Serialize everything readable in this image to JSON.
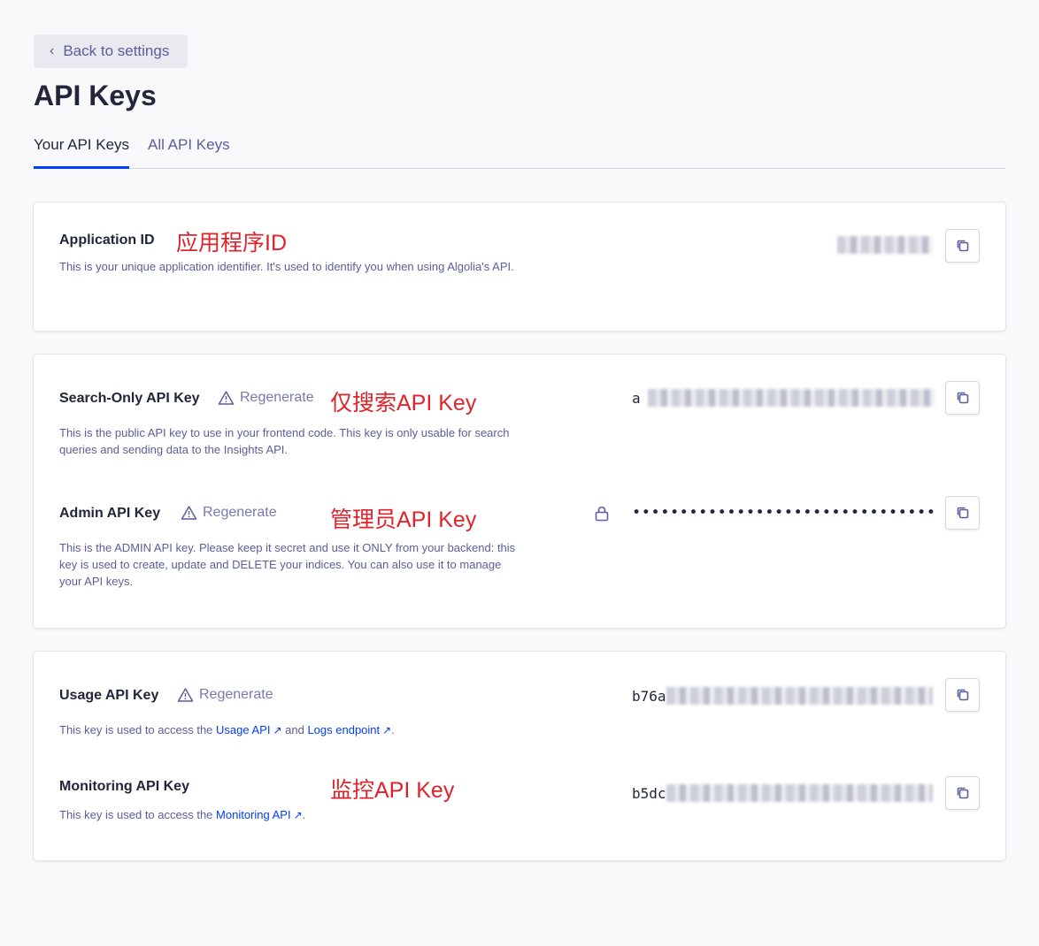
{
  "header": {
    "back_label": "Back to settings",
    "title": "API Keys"
  },
  "tabs": [
    {
      "label": "Your API Keys",
      "active": true
    },
    {
      "label": "All API Keys",
      "active": false
    }
  ],
  "application": {
    "title": "Application ID",
    "annotation": "应用程序ID",
    "description": "This is your unique application identifier. It's used to identify you when using Algolia's API."
  },
  "search_key": {
    "title": "Search-Only API Key",
    "regenerate": "Regenerate",
    "annotation": "仅搜索API Key",
    "value_prefix": "a",
    "description": "This is the public API key to use in your frontend code. This key is only usable for search queries and sending data to the Insights API."
  },
  "admin_key": {
    "title": "Admin API Key",
    "regenerate": "Regenerate",
    "annotation": "管理员API Key",
    "masked_value": "••••••••••••••••••••••••••••••••",
    "description": "This is the ADMIN API key. Please keep it secret and use it ONLY from your backend: this key is used to create, update and DELETE your indices. You can also use it to manage your API keys."
  },
  "usage_key": {
    "title": "Usage API Key",
    "regenerate": "Regenerate",
    "value_prefix": "b76a",
    "desc_before": "This key is used to access the ",
    "link1": "Usage API",
    "desc_middle": " and ",
    "link2": "Logs endpoint",
    "desc_after": "."
  },
  "monitoring_key": {
    "title": "Monitoring API Key",
    "annotation": "监控API Key",
    "value_prefix": "b5dc",
    "desc_before": "This key is used to access the ",
    "link1": "Monitoring API",
    "desc_after": "."
  },
  "colors": {
    "accent": "#003dff",
    "annotation": "#e0232a",
    "text": "#23263b",
    "muted": "#5a5e9a"
  },
  "icons": [
    "chevron-left-icon",
    "warning-icon",
    "copy-icon",
    "lock-icon",
    "external-link-icon"
  ]
}
